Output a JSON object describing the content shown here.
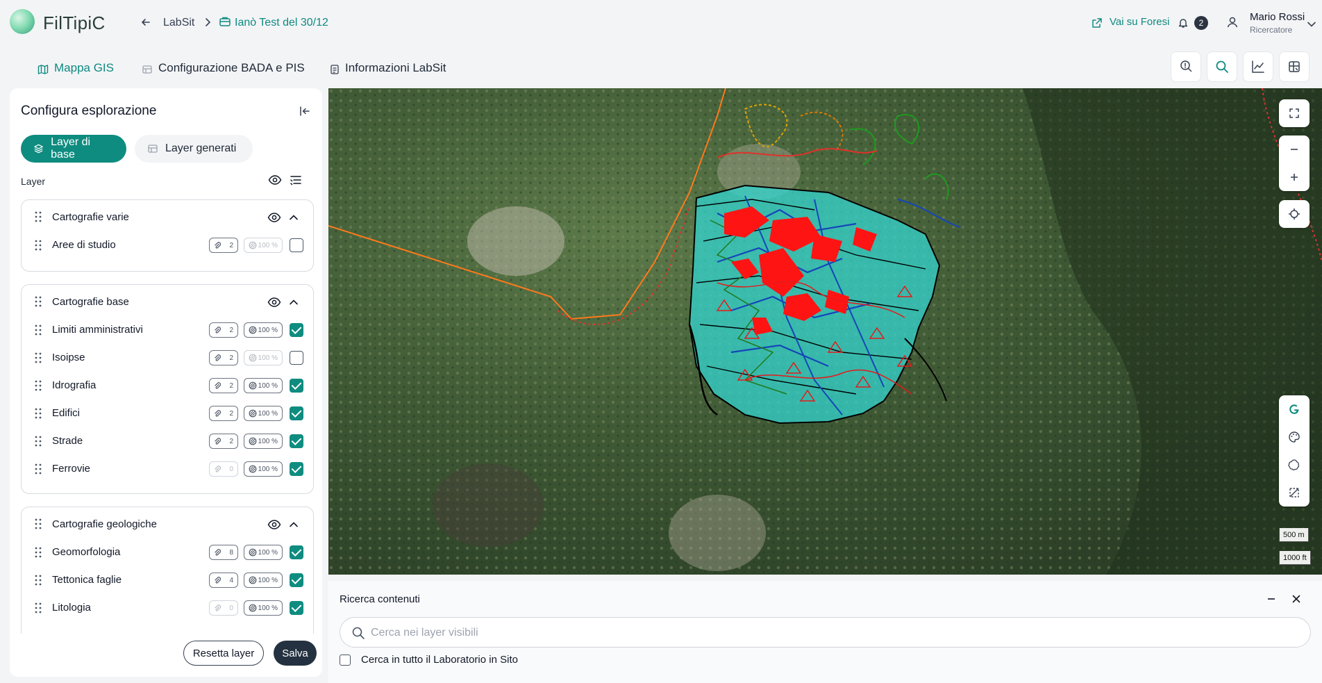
{
  "header": {
    "brand": "FilTipiC",
    "breadcrumb_root": "LabSit",
    "breadcrumb_current": "Ianò Test del 30/12",
    "external_link": "Vai su Foresi",
    "notifications_count": "2",
    "user_name": "Mario Rossi",
    "user_role": "Ricercatore"
  },
  "tabs": [
    {
      "label": "Mappa GIS",
      "active": true
    },
    {
      "label": "Configurazione BADA e PIS",
      "active": false
    },
    {
      "label": "Informazioni LabSit",
      "active": false
    }
  ],
  "sidebar": {
    "title": "Configura esplorazione",
    "pill_active": "Layer di base",
    "pill_inactive": "Layer generati",
    "layer_header": "Layer",
    "groups": [
      {
        "title": "Cartografie varie",
        "rows": [
          {
            "label": "Aree di studio",
            "count": "2",
            "opacity": "100 %",
            "checked": false
          }
        ]
      },
      {
        "title": "Cartografie base",
        "rows": [
          {
            "label": "Limiti amministrativi",
            "count": "2",
            "opacity": "100 %",
            "checked": true
          },
          {
            "label": "Isoipse",
            "count": "2",
            "opacity": "100 %",
            "checked": false
          },
          {
            "label": "Idrografia",
            "count": "2",
            "opacity": "100 %",
            "checked": true
          },
          {
            "label": "Edifici",
            "count": "2",
            "opacity": "100 %",
            "checked": true
          },
          {
            "label": "Strade",
            "count": "2",
            "opacity": "100 %",
            "checked": true
          },
          {
            "label": "Ferrovie",
            "count": "0",
            "opacity": "100 %",
            "checked": true
          }
        ]
      },
      {
        "title": "Cartografie geologiche",
        "rows": [
          {
            "label": "Geomorfologia",
            "count": "8",
            "opacity": "100 %",
            "checked": true
          },
          {
            "label": "Tettonica faglie",
            "count": "4",
            "opacity": "100 %",
            "checked": true
          },
          {
            "label": "Litologia",
            "count": "0",
            "opacity": "100 %",
            "checked": true
          }
        ]
      }
    ],
    "reset_label": "Resetta layer",
    "save_label": "Salva"
  },
  "map": {
    "scale_metric": "500 m",
    "scale_imperial": "1000 ft"
  },
  "search": {
    "title": "Ricerca contenuti",
    "placeholder": "Cerca nei layer visibili",
    "checkbox_label": "Cerca in tutto il Laboratorio in Sito"
  },
  "colors": {
    "accent": "#0f8c80",
    "dark_button": "#243140",
    "map_fill": "#33d6d0",
    "map_red": "#ff1414"
  }
}
